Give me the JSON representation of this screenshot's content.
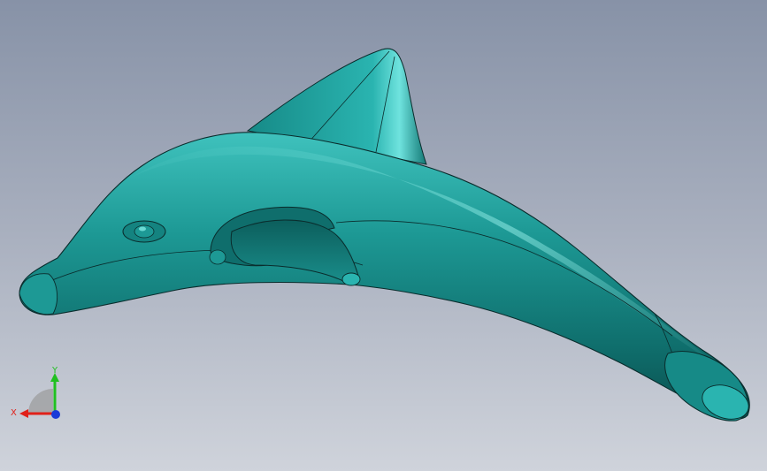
{
  "viewport": {
    "background_top": "#8792a7",
    "background_bottom": "#cfd3db",
    "model": {
      "name": "dolphin",
      "color": "#1a8f8c",
      "edge_color": "#0a2c2c"
    },
    "triad": {
      "x_label": "X",
      "y_label": "Y",
      "x_color": "#e0201a",
      "y_color": "#20c020",
      "z_color": "#1a3ad8"
    }
  }
}
